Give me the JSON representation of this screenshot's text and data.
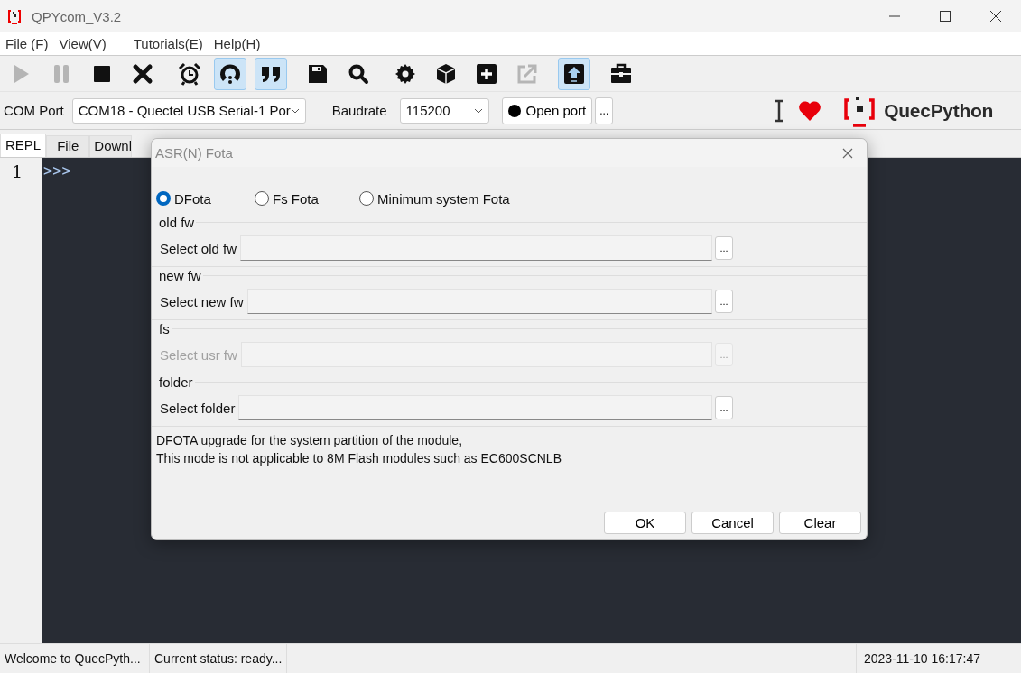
{
  "window": {
    "title": "QPYcom_V3.2"
  },
  "menu": [
    "File (F)",
    "View(V)",
    "Tutorials(E)",
    "Help(H)"
  ],
  "toolbar": {
    "groups": [
      {
        "tools": [
          {
            "kind": "play",
            "selected": false,
            "disabled": true
          },
          {
            "kind": "pause",
            "selected": false,
            "disabled": true
          },
          {
            "kind": "stop",
            "selected": false,
            "disabled": false
          },
          {
            "kind": "close",
            "selected": false,
            "disabled": false
          }
        ]
      },
      {
        "tools": [
          {
            "kind": "alarm",
            "selected": false,
            "disabled": false
          },
          {
            "kind": "ring",
            "selected": true,
            "disabled": false
          },
          {
            "kind": "quote",
            "selected": true,
            "disabled": false
          }
        ]
      },
      {
        "tools": [
          {
            "kind": "save",
            "selected": false,
            "disabled": false
          },
          {
            "kind": "search",
            "selected": false,
            "disabled": false
          }
        ]
      },
      {
        "tools": [
          {
            "kind": "gear",
            "selected": false,
            "disabled": false
          },
          {
            "kind": "cube",
            "selected": false,
            "disabled": false
          },
          {
            "kind": "plus",
            "selected": false,
            "disabled": false
          },
          {
            "kind": "export",
            "selected": false,
            "disabled": true
          }
        ]
      },
      {
        "tools": [
          {
            "kind": "upload",
            "selected": true,
            "disabled": false
          }
        ]
      },
      {
        "tools": [
          {
            "kind": "toolbox",
            "selected": false,
            "disabled": false
          }
        ]
      }
    ]
  },
  "port_bar": {
    "com_label": "COM Port",
    "com_value": "COM18 - Quectel USB Serial-1 Por",
    "baud_label": "Baudrate",
    "baud_value": "115200",
    "open_button": "Open port",
    "more_button": "...",
    "brand": "QuecPython"
  },
  "tabs": [
    {
      "label": "REPL",
      "selected": true
    },
    {
      "label": "File",
      "selected": false
    },
    {
      "label": "Downl",
      "selected": false
    }
  ],
  "editor": {
    "line_number": "1",
    "prompt": ">>>"
  },
  "dialog": {
    "title": "ASR(N) Fota",
    "modes": [
      {
        "label": "DFota",
        "selected": true
      },
      {
        "label": "Fs Fota",
        "selected": false
      },
      {
        "label": "Minimum system Fota",
        "selected": false
      }
    ],
    "groups": [
      {
        "title": "old fw",
        "label": "Select old fw",
        "button": "...",
        "disabled": false
      },
      {
        "title": "new fw",
        "label": "Select new fw",
        "button": "...",
        "disabled": false
      },
      {
        "title": "fs",
        "label": "Select usr fw",
        "button": "...",
        "disabled": true
      },
      {
        "title": "folder",
        "label": "Select folder",
        "button": "...",
        "disabled": false
      }
    ],
    "description": [
      "DFOTA upgrade for the system partition of the module,",
      "This mode is not applicable to 8M Flash modules such as EC600SCNLB"
    ],
    "buttons": [
      "OK",
      "Cancel",
      "Clear"
    ]
  },
  "status_bar": {
    "welcome": "Welcome to QuecPyth...",
    "status": "Current status: ready...",
    "time": "2023-11-10 16:17:47"
  }
}
